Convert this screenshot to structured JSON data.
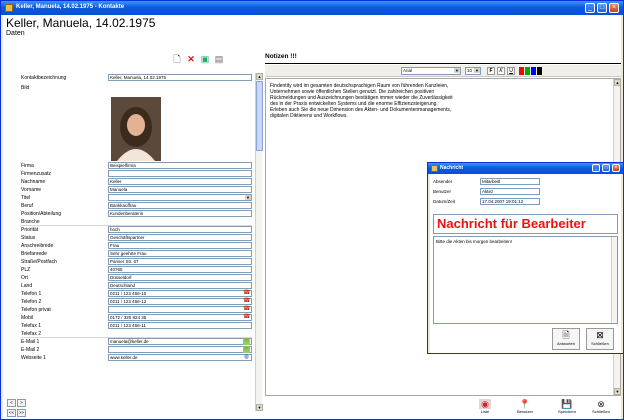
{
  "window": {
    "title": "Keller, Manuela, 14.02.1975 - Kontakte",
    "minimize": "_",
    "maximize": "□",
    "close": "×"
  },
  "header": {
    "name": "Keller, Manuela, 14.02.1975",
    "section": "Daten"
  },
  "form_toolbar": {
    "icons": [
      "new-document-icon",
      "delete-icon",
      "image-icon",
      "list-icon"
    ]
  },
  "fields": [
    {
      "label": "Kontaktbezeichnung",
      "value": "Keller, Manuela, 14.02.1975"
    },
    {
      "label": "Bild",
      "value": ""
    },
    {
      "label": "Firma",
      "value": "Beispielfirma"
    },
    {
      "label": "Firmenzusatz",
      "value": ""
    },
    {
      "label": "Nachname",
      "value": "Keller"
    },
    {
      "label": "Vorname",
      "value": "Manuela"
    },
    {
      "label": "Titel",
      "value": ""
    },
    {
      "label": "Beruf",
      "value": "Bankkauffrau"
    },
    {
      "label": "Position/Abteilung",
      "value": "Kundenberaterin"
    },
    {
      "label": "Branche",
      "value": ""
    },
    {
      "label": "Priorität",
      "value": "hoch"
    },
    {
      "label": "Status",
      "value": "Geschäftspartner"
    },
    {
      "label": "Anschreibrede",
      "value": "Frau"
    },
    {
      "label": "Briefanrede",
      "value": "Sehr geehrte Frau"
    },
    {
      "label": "Straße/Postfach",
      "value": "Pariser Str. 67"
    },
    {
      "label": "PLZ",
      "value": "40765"
    },
    {
      "label": "Ort",
      "value": "Düsseldorf"
    },
    {
      "label": "Land",
      "value": "Deutschland"
    },
    {
      "label": "Telefon 1",
      "value": "0211 / 123 456-10"
    },
    {
      "label": "Telefon 2",
      "value": "0211 / 123 456-12"
    },
    {
      "label": "Telefon privat",
      "value": ""
    },
    {
      "label": "Mobil",
      "value": "0172 / 320 824 35"
    },
    {
      "label": "Telefax 1",
      "value": "0211 / 123 456-11"
    },
    {
      "label": "Telefax 2",
      "value": ""
    },
    {
      "label": "E-Mail 1",
      "value": "manuela@keller.de"
    },
    {
      "label": "E-Mail 2",
      "value": ""
    },
    {
      "label": "Webseite 1",
      "value": "www.keller.de"
    }
  ],
  "nav": {
    "prev": "<",
    "next": ">",
    "first": "<<",
    "last": ">>"
  },
  "notes": {
    "tab_label": "Notizen !!!",
    "font_name": "Arial",
    "font_size": "10",
    "format_buttons": [
      "F",
      "K",
      "U"
    ],
    "colors": [
      "#ff0000",
      "#00aa00",
      "#0000ff",
      "#000000"
    ],
    "lines": [
      "Findentity wird im gesamten deutschsprachigen Raum von führenden Kanzleien,",
      "Unternehmen sowie öffentlichen Stellen genutzt. Die zahlreichen positiven",
      "Rückmeldungen und Auszeichnungen bestätigen immer wieder die Zuverlässigkeit",
      "des in der Praxis entwickelten Systems und die enorme Effizienzsteigerung.",
      "Erleben auch Sie die neue Dimension des Akten- und Dokumentenmanagements,",
      "digitalen Diktierens und Workflows."
    ]
  },
  "bottom_actions": [
    {
      "label": "Liste",
      "icon": "list-icon"
    },
    {
      "label": "Benutzer",
      "icon": "user-pin-icon"
    },
    {
      "label": "Speichern",
      "icon": "save-icon"
    },
    {
      "label": "Schließen",
      "icon": "close-icon"
    }
  ],
  "popup": {
    "title": "Nachricht",
    "fields": [
      {
        "label": "Absender",
        "value": "Mitarbeitl"
      },
      {
        "label": "Benutzer",
        "value": "Aktez"
      },
      {
        "label": "Datum/Zeit",
        "value": "17.04.2007 19:01:12"
      }
    ],
    "headline": "Nachricht für Bearbeiter",
    "message": "Bitte die Akten bis morgen bearbeiten!",
    "buttons": [
      {
        "label": "Antworten",
        "icon": "reply-icon"
      },
      {
        "label": "Schließen",
        "icon": "close-icon"
      }
    ]
  }
}
